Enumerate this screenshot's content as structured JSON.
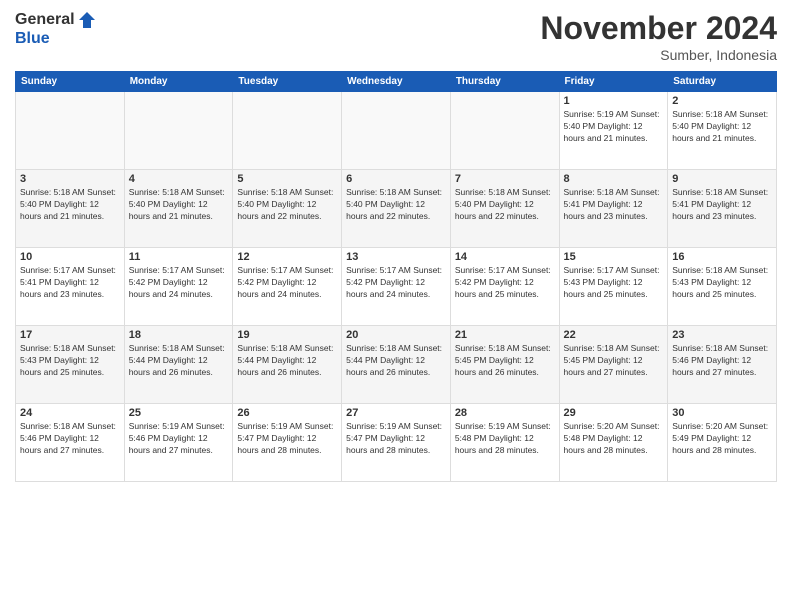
{
  "logo": {
    "general": "General",
    "blue": "Blue"
  },
  "header": {
    "month": "November 2024",
    "location": "Sumber, Indonesia"
  },
  "weekdays": [
    "Sunday",
    "Monday",
    "Tuesday",
    "Wednesday",
    "Thursday",
    "Friday",
    "Saturday"
  ],
  "weeks": [
    [
      {
        "day": "",
        "info": ""
      },
      {
        "day": "",
        "info": ""
      },
      {
        "day": "",
        "info": ""
      },
      {
        "day": "",
        "info": ""
      },
      {
        "day": "",
        "info": ""
      },
      {
        "day": "1",
        "info": "Sunrise: 5:19 AM\nSunset: 5:40 PM\nDaylight: 12 hours\nand 21 minutes."
      },
      {
        "day": "2",
        "info": "Sunrise: 5:18 AM\nSunset: 5:40 PM\nDaylight: 12 hours\nand 21 minutes."
      }
    ],
    [
      {
        "day": "3",
        "info": "Sunrise: 5:18 AM\nSunset: 5:40 PM\nDaylight: 12 hours\nand 21 minutes."
      },
      {
        "day": "4",
        "info": "Sunrise: 5:18 AM\nSunset: 5:40 PM\nDaylight: 12 hours\nand 21 minutes."
      },
      {
        "day": "5",
        "info": "Sunrise: 5:18 AM\nSunset: 5:40 PM\nDaylight: 12 hours\nand 22 minutes."
      },
      {
        "day": "6",
        "info": "Sunrise: 5:18 AM\nSunset: 5:40 PM\nDaylight: 12 hours\nand 22 minutes."
      },
      {
        "day": "7",
        "info": "Sunrise: 5:18 AM\nSunset: 5:40 PM\nDaylight: 12 hours\nand 22 minutes."
      },
      {
        "day": "8",
        "info": "Sunrise: 5:18 AM\nSunset: 5:41 PM\nDaylight: 12 hours\nand 23 minutes."
      },
      {
        "day": "9",
        "info": "Sunrise: 5:18 AM\nSunset: 5:41 PM\nDaylight: 12 hours\nand 23 minutes."
      }
    ],
    [
      {
        "day": "10",
        "info": "Sunrise: 5:17 AM\nSunset: 5:41 PM\nDaylight: 12 hours\nand 23 minutes."
      },
      {
        "day": "11",
        "info": "Sunrise: 5:17 AM\nSunset: 5:42 PM\nDaylight: 12 hours\nand 24 minutes."
      },
      {
        "day": "12",
        "info": "Sunrise: 5:17 AM\nSunset: 5:42 PM\nDaylight: 12 hours\nand 24 minutes."
      },
      {
        "day": "13",
        "info": "Sunrise: 5:17 AM\nSunset: 5:42 PM\nDaylight: 12 hours\nand 24 minutes."
      },
      {
        "day": "14",
        "info": "Sunrise: 5:17 AM\nSunset: 5:42 PM\nDaylight: 12 hours\nand 25 minutes."
      },
      {
        "day": "15",
        "info": "Sunrise: 5:17 AM\nSunset: 5:43 PM\nDaylight: 12 hours\nand 25 minutes."
      },
      {
        "day": "16",
        "info": "Sunrise: 5:18 AM\nSunset: 5:43 PM\nDaylight: 12 hours\nand 25 minutes."
      }
    ],
    [
      {
        "day": "17",
        "info": "Sunrise: 5:18 AM\nSunset: 5:43 PM\nDaylight: 12 hours\nand 25 minutes."
      },
      {
        "day": "18",
        "info": "Sunrise: 5:18 AM\nSunset: 5:44 PM\nDaylight: 12 hours\nand 26 minutes."
      },
      {
        "day": "19",
        "info": "Sunrise: 5:18 AM\nSunset: 5:44 PM\nDaylight: 12 hours\nand 26 minutes."
      },
      {
        "day": "20",
        "info": "Sunrise: 5:18 AM\nSunset: 5:44 PM\nDaylight: 12 hours\nand 26 minutes."
      },
      {
        "day": "21",
        "info": "Sunrise: 5:18 AM\nSunset: 5:45 PM\nDaylight: 12 hours\nand 26 minutes."
      },
      {
        "day": "22",
        "info": "Sunrise: 5:18 AM\nSunset: 5:45 PM\nDaylight: 12 hours\nand 27 minutes."
      },
      {
        "day": "23",
        "info": "Sunrise: 5:18 AM\nSunset: 5:46 PM\nDaylight: 12 hours\nand 27 minutes."
      }
    ],
    [
      {
        "day": "24",
        "info": "Sunrise: 5:18 AM\nSunset: 5:46 PM\nDaylight: 12 hours\nand 27 minutes."
      },
      {
        "day": "25",
        "info": "Sunrise: 5:19 AM\nSunset: 5:46 PM\nDaylight: 12 hours\nand 27 minutes."
      },
      {
        "day": "26",
        "info": "Sunrise: 5:19 AM\nSunset: 5:47 PM\nDaylight: 12 hours\nand 28 minutes."
      },
      {
        "day": "27",
        "info": "Sunrise: 5:19 AM\nSunset: 5:47 PM\nDaylight: 12 hours\nand 28 minutes."
      },
      {
        "day": "28",
        "info": "Sunrise: 5:19 AM\nSunset: 5:48 PM\nDaylight: 12 hours\nand 28 minutes."
      },
      {
        "day": "29",
        "info": "Sunrise: 5:20 AM\nSunset: 5:48 PM\nDaylight: 12 hours\nand 28 minutes."
      },
      {
        "day": "30",
        "info": "Sunrise: 5:20 AM\nSunset: 5:49 PM\nDaylight: 12 hours\nand 28 minutes."
      }
    ]
  ]
}
